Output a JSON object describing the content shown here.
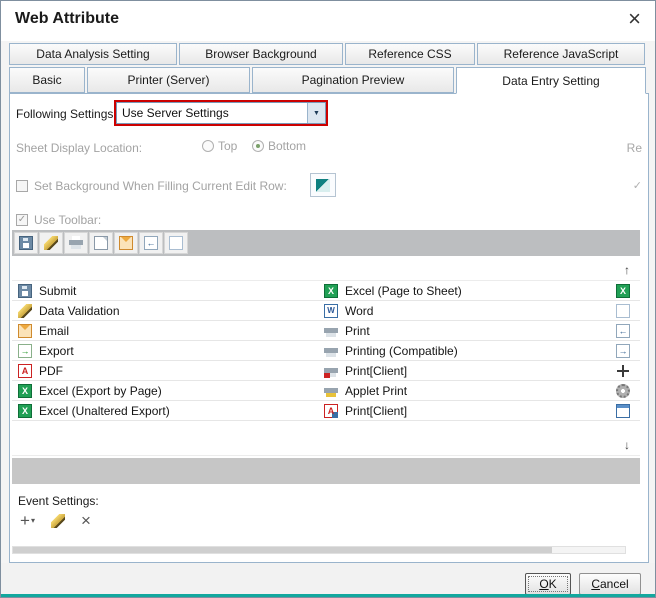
{
  "window": {
    "title": "Web Attribute",
    "close_glyph": "×"
  },
  "colors": {
    "highlight_red": "#cc0000",
    "bottom_strip_teal": "#13a89e",
    "excel_green": "#21a055",
    "pdf_red": "#cc2222",
    "word_blue": "#2b5797"
  },
  "tabs": {
    "row1": [
      "Data Analysis Setting",
      "Browser Background",
      "Reference CSS",
      "Reference JavaScript"
    ],
    "row2": [
      "Basic",
      "Printer (Server)",
      "Pagination Preview",
      "Data Entry Setting"
    ],
    "active": "Data Entry Setting"
  },
  "form": {
    "following_settings": {
      "label": "Following Settings:",
      "value": "Use Server Settings",
      "arrow_glyph": "▼"
    },
    "sheet_display": {
      "label": "Sheet Display Location:",
      "disabled": true,
      "options": [
        {
          "label": "Top",
          "selected": false
        },
        {
          "label": "Bottom",
          "selected": true
        }
      ]
    },
    "clipped_right_text": "Re",
    "set_background": {
      "label": "Set Background When Filling Current Edit Row:",
      "checked": false,
      "disabled": true,
      "right_check_glyph": "✓"
    },
    "use_toolbar": {
      "label": "Use Toolbar:",
      "checked": true,
      "disabled": true,
      "check_glyph": "✓"
    }
  },
  "toolbar_preview": {
    "icons": [
      "save",
      "pencil",
      "print",
      "doc",
      "email",
      "arrow-left",
      "blank"
    ]
  },
  "toolbar_list": {
    "scroll_up_glyph": "↑",
    "scroll_down_glyph": "↓",
    "rows": [
      {
        "left": {
          "icon": "save",
          "label": "Submit"
        },
        "right": {
          "icon": "excel",
          "label": "Excel (Page to Sheet)"
        },
        "edge": "excel"
      },
      {
        "left": {
          "icon": "pencil",
          "label": "Data Validation"
        },
        "right": {
          "icon": "word",
          "label": "Word"
        },
        "edge": "blank"
      },
      {
        "left": {
          "icon": "email",
          "label": "Email"
        },
        "right": {
          "icon": "print",
          "label": "Print"
        },
        "edge": "arrow-left"
      },
      {
        "left": {
          "icon": "export",
          "label": "Export"
        },
        "right": {
          "icon": "print",
          "label": "Printing (Compatible)"
        },
        "edge": "arrow-right"
      },
      {
        "left": {
          "icon": "pdf",
          "label": "PDF"
        },
        "right": {
          "icon": "print-client",
          "label": "Print[Client]"
        },
        "edge": "move"
      },
      {
        "left": {
          "icon": "excel",
          "label": "Excel (Export by Page)"
        },
        "right": {
          "icon": "applet-print",
          "label": "Applet Print"
        },
        "edge": "gear"
      },
      {
        "left": {
          "icon": "excel",
          "label": "Excel (Unaltered Export)"
        },
        "right": {
          "icon": "pdf-client",
          "label": "Print[Client]"
        },
        "edge": "calendar"
      }
    ]
  },
  "event_settings": {
    "label": "Event Settings:",
    "buttons": [
      {
        "name": "add",
        "glyph": "+",
        "has_dropdown": true,
        "dropdown_glyph": "▾"
      },
      {
        "name": "edit",
        "icon": "pencil"
      },
      {
        "name": "delete",
        "glyph": "×"
      }
    ]
  },
  "footer": {
    "ok_label": "OK",
    "cancel_label": "Cancel"
  }
}
